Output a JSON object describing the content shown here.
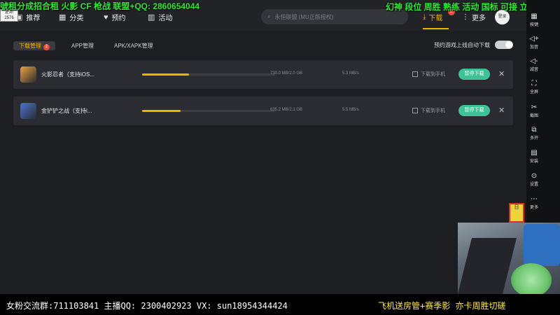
{
  "overlay": {
    "top_left": "號租分成招合租 火影 CF 枪战 联盟+QQ: 2860654044",
    "top_right": "幻神 段位 周胜 熟练 活动 国标 可接 立马打",
    "logo_line1": "逆邦",
    "logo_line2": "2576",
    "bottom_left": "女粉交流群:711103841  主播QQ: 2300402923 VX: sun18954344424",
    "bottom_right": "飞机送房管+赛季影 亦卡周胜切磋",
    "sticker": "日"
  },
  "nav": {
    "recommend": "推荐",
    "category": "分类",
    "reserve": "预约",
    "activity": "活动",
    "search_placeholder": "永恒联盟 (MU正版授权)",
    "download": "下载",
    "download_badge": "2",
    "more": "更多",
    "login": "登录"
  },
  "subtabs": {
    "download_manage": "下载管理",
    "download_manage_badge": "2",
    "app_manage": "APP管理",
    "apk_manage": "APK/XAPK管理",
    "auto_download_label": "预约游戏上线自动下载",
    "auto_download_on": true
  },
  "downloads": [
    {
      "name": "火影忍者（支持iOS...",
      "progress": 0.35,
      "size": "730.0 MB/2.0 GB",
      "speed": "5.3 MB/s",
      "to_phone": "下载到手机",
      "pause": "暂停下载",
      "icon_color": "#e9a23b"
    },
    {
      "name": "金铲铲之战（支持i...",
      "progress": 0.29,
      "size": "635.2 MB/2.1 GB",
      "speed": "5.5 MB/s",
      "to_phone": "下载到手机",
      "pause": "暂停下载",
      "icon_color": "#4a74d6"
    }
  ],
  "sidebar": [
    {
      "label": "按键",
      "icon": "keyboard-icon",
      "glyph": "▦"
    },
    {
      "label": "加音",
      "icon": "volume-up-icon",
      "glyph": "◁+"
    },
    {
      "label": "减音",
      "icon": "volume-down-icon",
      "glyph": "◁-"
    },
    {
      "label": "全屏",
      "icon": "fullscreen-icon",
      "glyph": "⛶"
    },
    {
      "label": "截图",
      "icon": "scissors-icon",
      "glyph": "✂"
    },
    {
      "label": "多开",
      "icon": "multi-open-icon",
      "glyph": "⧉"
    },
    {
      "label": "安装",
      "icon": "apk-install-icon",
      "glyph": "▤"
    },
    {
      "label": "设置",
      "icon": "settings-icon",
      "glyph": "⊙"
    },
    {
      "label": "更多",
      "icon": "more-icon",
      "glyph": "⋯"
    }
  ]
}
